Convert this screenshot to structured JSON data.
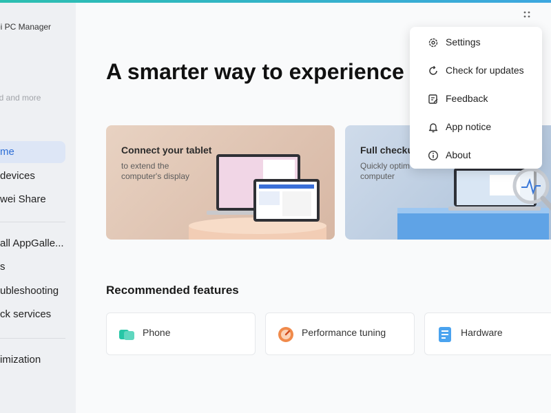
{
  "app": {
    "title": "ei PC Manager"
  },
  "sidebar": {
    "subtitle": "ud and more",
    "items": [
      {
        "label": "me",
        "active": true
      },
      {
        "label": "devices"
      },
      {
        "label": "wei Share"
      },
      {
        "label": "all AppGalle..."
      },
      {
        "label": "s"
      },
      {
        "label": "ubleshooting"
      },
      {
        "label": "ck services"
      },
      {
        "label": "imization"
      }
    ]
  },
  "main": {
    "hero_title": "A smarter way to experience y",
    "cards": [
      {
        "title": "Connect your tablet",
        "subtitle": "to extend the computer's display"
      },
      {
        "title": "Full checku",
        "subtitle": "Quickly optim computer"
      }
    ],
    "section_title": "Recommended features",
    "features": [
      {
        "label": "Phone",
        "icon": "phone-icon"
      },
      {
        "label": "Performance tuning",
        "icon": "gauge-icon"
      },
      {
        "label": "Hardware",
        "icon": "hardware-icon"
      }
    ]
  },
  "menu": {
    "items": [
      {
        "label": "Settings",
        "icon": "gear-icon"
      },
      {
        "label": "Check for updates",
        "icon": "refresh-icon"
      },
      {
        "label": "Feedback",
        "icon": "feedback-icon"
      },
      {
        "label": "App notice",
        "icon": "bell-icon"
      },
      {
        "label": "About",
        "icon": "info-icon"
      }
    ]
  },
  "colors": {
    "accent": "#2f6fd6",
    "topbar": "#2bbfb0",
    "active_bg": "#dde6f6"
  }
}
